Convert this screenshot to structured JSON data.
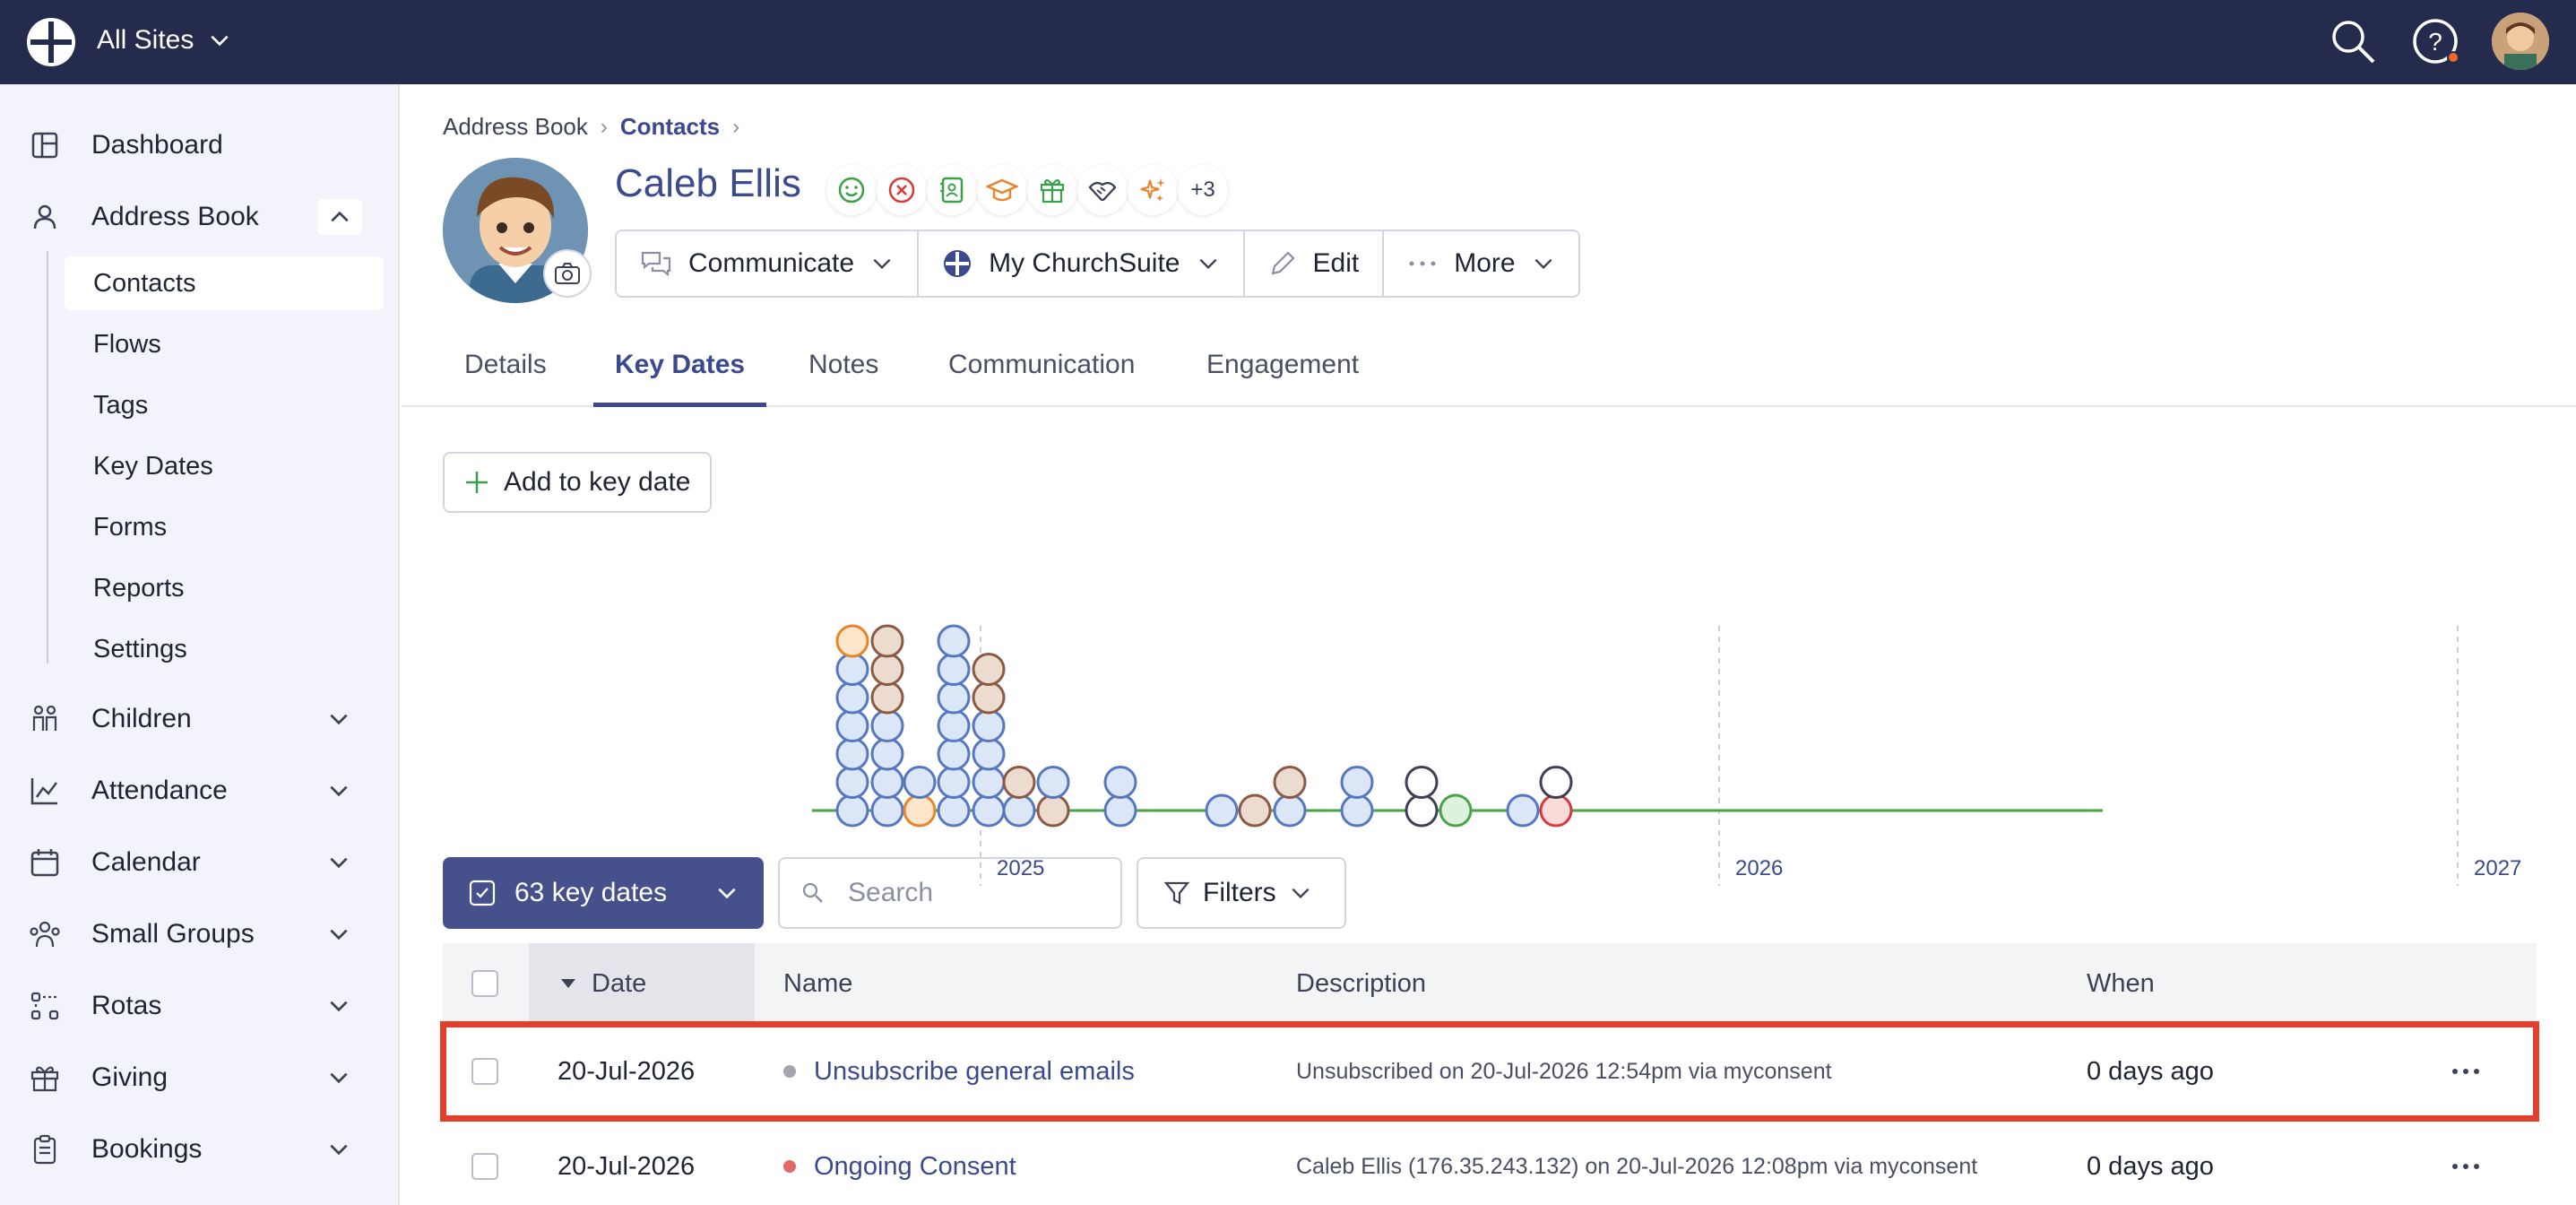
{
  "topbar": {
    "site_selector": "All Sites",
    "icons": [
      "search-icon",
      "help-icon",
      "user-avatar"
    ]
  },
  "sidebar": {
    "items": [
      {
        "label": "Dashboard",
        "icon": "dashboard-icon"
      },
      {
        "label": "Address Book",
        "icon": "person-icon",
        "expanded": true
      },
      {
        "label": "Children",
        "icon": "children-icon"
      },
      {
        "label": "Attendance",
        "icon": "chart-icon"
      },
      {
        "label": "Calendar",
        "icon": "calendar-icon"
      },
      {
        "label": "Small Groups",
        "icon": "groups-icon"
      },
      {
        "label": "Rotas",
        "icon": "rotas-icon"
      },
      {
        "label": "Giving",
        "icon": "gift-icon"
      },
      {
        "label": "Bookings",
        "icon": "clipboard-icon"
      }
    ],
    "address_book_sub": [
      "Contacts",
      "Flows",
      "Tags",
      "Key Dates",
      "Forms",
      "Reports",
      "Settings"
    ],
    "active_sub": "Contacts"
  },
  "breadcrumb": {
    "root": "Address Book",
    "current": "Contacts"
  },
  "contact": {
    "name": "Caleb Ellis",
    "badges": [
      "smile-icon",
      "x-circle-icon",
      "contacts-icon",
      "graduation-icon",
      "gift-icon",
      "handshake-icon",
      "sparkle-icon"
    ],
    "badge_more": "+3"
  },
  "actions": {
    "communicate": "Communicate",
    "my_churchsuite": "My ChurchSuite",
    "edit": "Edit",
    "more": "More"
  },
  "tabs": [
    "Details",
    "Key Dates",
    "Notes",
    "Communication",
    "Engagement"
  ],
  "active_tab": "Key Dates",
  "add_key_date": "Add to key date",
  "timeline": {
    "year_labels": [
      "2025",
      "2026",
      "2027"
    ]
  },
  "toolbar": {
    "key_dates_count": "63 key dates",
    "search_placeholder": "Search",
    "filters": "Filters"
  },
  "table": {
    "headers": {
      "date": "Date",
      "name": "Name",
      "description": "Description",
      "when": "When"
    },
    "rows": [
      {
        "date": "20-Jul-2026",
        "name": "Unsubscribe general emails",
        "dot_color": "#a3a6b0",
        "description": "Unsubscribed on 20-Jul-2026 12:54pm via myconsent",
        "when": "0 days ago"
      },
      {
        "date": "20-Jul-2026",
        "name": "Ongoing Consent",
        "dot_color": "#e06a6a",
        "description": "Caleb Ellis (176.35.243.132) on 20-Jul-2026 12:08pm via myconsent",
        "when": "0 days ago"
      }
    ]
  },
  "colors": {
    "topbar": "#242b4d",
    "primary": "#3b4a8f",
    "highlight": "#e2402c",
    "timeline_line": "#4aa24a"
  }
}
